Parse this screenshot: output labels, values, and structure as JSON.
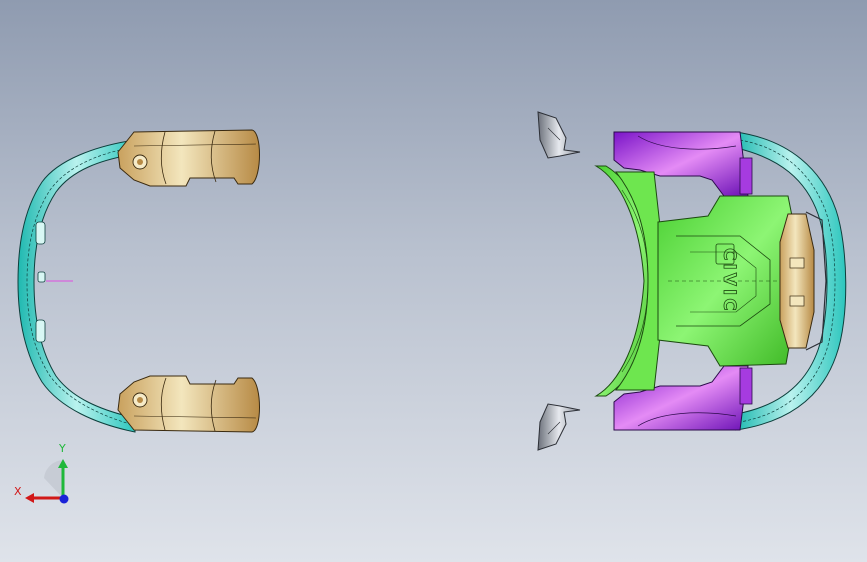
{
  "viewport": {
    "background_top": "#8f9bb0",
    "background_bottom": "#dfe3ea"
  },
  "model": {
    "parts": [
      {
        "name": "rear-bumper-beam",
        "color": "#4fdac8"
      },
      {
        "name": "headlamp-housing",
        "color": "#e7d3a1"
      },
      {
        "name": "front-bumper-cover",
        "color": "#4fdac8"
      },
      {
        "name": "front-panel",
        "color": "#8d1fd8"
      },
      {
        "name": "center-reinforcement",
        "color": "#56e03c"
      },
      {
        "name": "tow-bracket",
        "color": "#e7d3a1"
      },
      {
        "name": "side-bracket",
        "color": "#b7bcc6"
      }
    ],
    "embossed_text": "CIVIC"
  },
  "triad": {
    "y_label": "Y",
    "x_label": "X",
    "y_color": "#1fb83a",
    "x_color": "#d11818",
    "z_color": "#1a22d8"
  }
}
